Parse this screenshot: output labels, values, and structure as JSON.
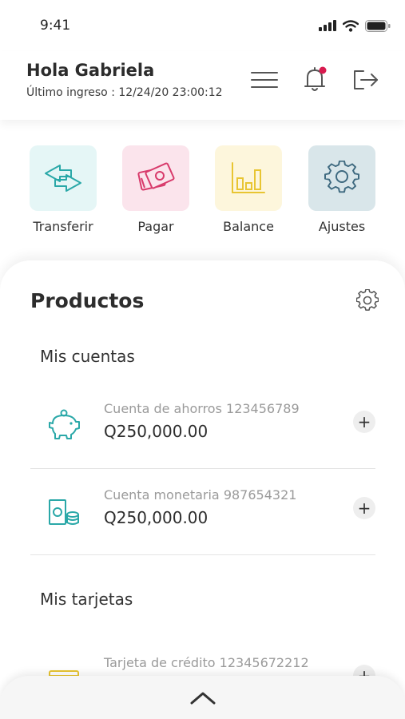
{
  "status_bar": {
    "time": "9:41"
  },
  "header": {
    "greeting": "Hola Gabriela",
    "last_login": "Último ingreso : 12/24/20 23:00:12"
  },
  "quick_actions": [
    {
      "label": "Transferir",
      "icon": "transfer-arrows-icon",
      "bg": "#e5f6f6",
      "color": "#2aa8a8"
    },
    {
      "label": "Pagar",
      "icon": "cash-icon",
      "bg": "#fbe4ec",
      "color": "#d83a6b"
    },
    {
      "label": "Balance",
      "icon": "bar-chart-icon",
      "bg": "#fdf6dc",
      "color": "#e8c532"
    },
    {
      "label": "Ajustes",
      "icon": "gear-icon",
      "bg": "#d9e6ea",
      "color": "#3f6a80"
    }
  ],
  "products": {
    "title": "Productos",
    "accounts_section": "Mis cuentas",
    "accounts": [
      {
        "name": "Cuenta de ahorros 123456789",
        "balance": "Q250,000.00",
        "icon": "piggy-bank-icon"
      },
      {
        "name": "Cuenta monetaria 987654321",
        "balance": "Q250,000.00",
        "icon": "money-coins-icon"
      }
    ],
    "cards_section": "Mis tarjetas",
    "cards": [
      {
        "name": "Tarjeta de crédito 12345672212",
        "icon": "credit-card-icon"
      }
    ],
    "plus_label": "+"
  },
  "colors": {
    "teal": "#2aa8a8",
    "pink": "#d83a6b",
    "yellow": "#e8c532",
    "notification_dot": "#d81b4f"
  }
}
